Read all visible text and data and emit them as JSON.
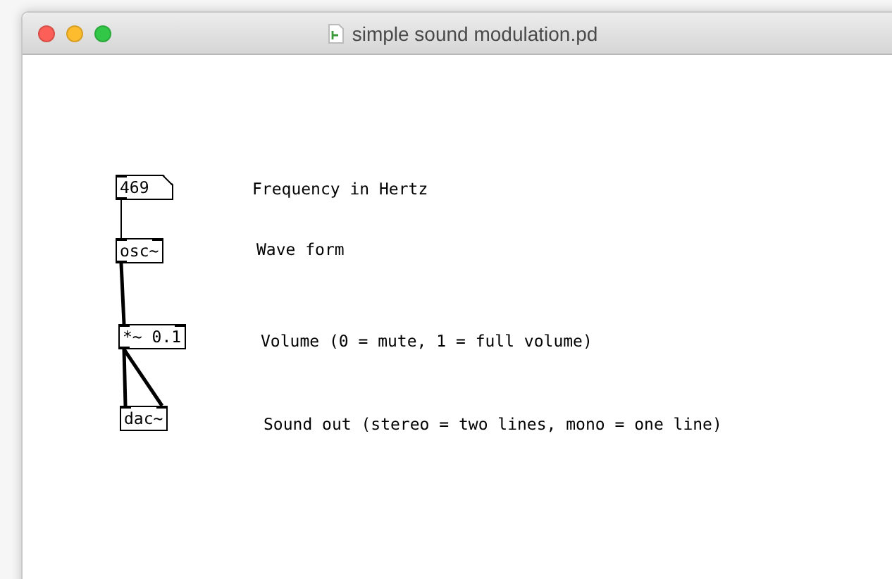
{
  "window": {
    "title": "simple sound modulation.pd"
  },
  "boxes": [
    {
      "kind": "number",
      "text": "469"
    },
    {
      "kind": "object",
      "text": "osc~"
    },
    {
      "kind": "object",
      "text": "*~ 0.1"
    },
    {
      "kind": "object",
      "text": "dac~"
    }
  ],
  "comments": [
    "Frequency in Hertz",
    "Wave form",
    "Volume (0 = mute, 1 = full volume)",
    "Sound out (stereo = two lines, mono = one line)"
  ]
}
